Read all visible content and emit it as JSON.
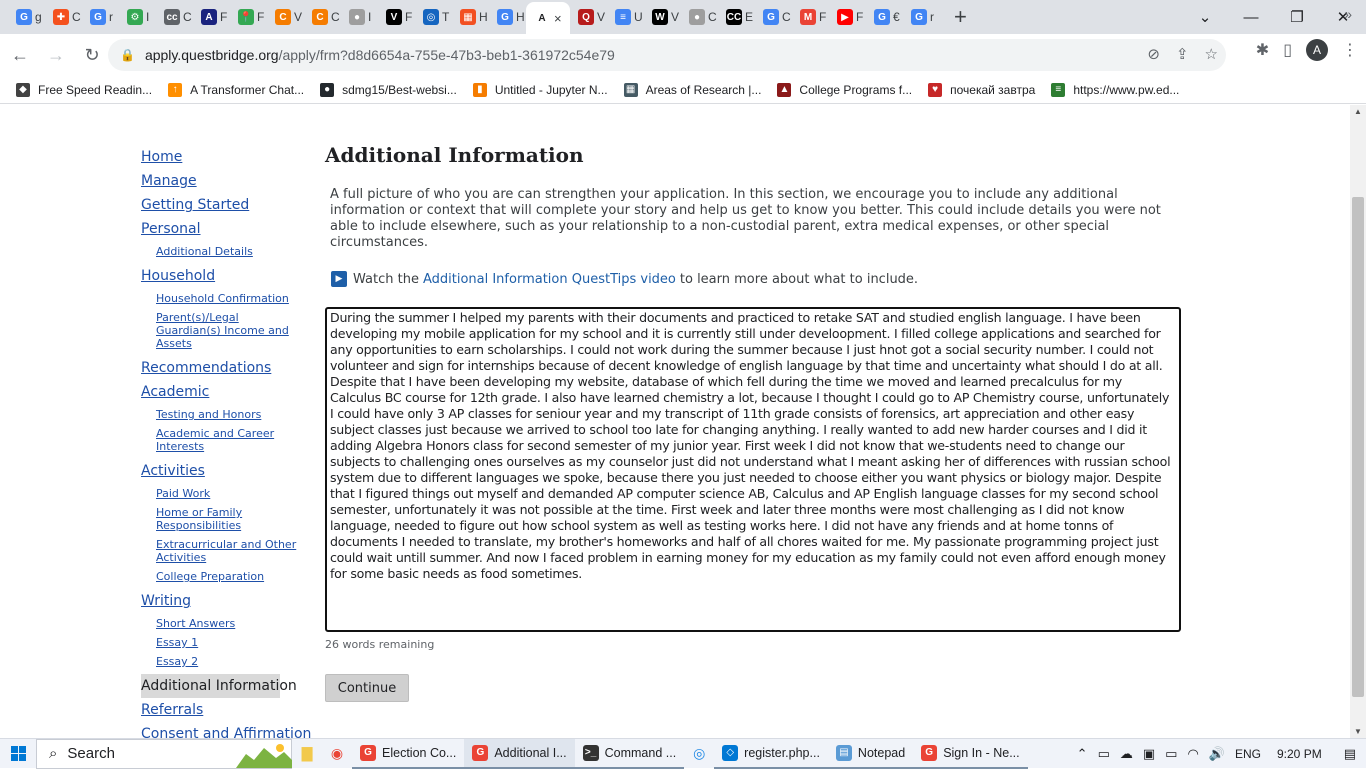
{
  "browser": {
    "tabs": [
      {
        "label": "G",
        "title": "g",
        "color": "#4285f4"
      },
      {
        "label": "✚",
        "title": "C",
        "color": "#f4511e"
      },
      {
        "label": "G",
        "title": "r",
        "color": "#4285f4"
      },
      {
        "label": "⚙",
        "title": "I",
        "color": "#34a853"
      },
      {
        "label": "cc",
        "title": "C",
        "color": "#5f6368"
      },
      {
        "label": "A",
        "title": "F",
        "color": "#1a237e"
      },
      {
        "label": "📍",
        "title": "F",
        "color": "#34a853"
      },
      {
        "label": "C",
        "title": "V",
        "color": "#f57c00"
      },
      {
        "label": "C",
        "title": "C",
        "color": "#f57c00"
      },
      {
        "label": "●",
        "title": "I",
        "color": "#9e9e9e"
      },
      {
        "label": "V",
        "title": "F",
        "color": "#000000"
      },
      {
        "label": "◎",
        "title": "T",
        "color": "#1565c0"
      },
      {
        "label": "▦",
        "title": "H",
        "color": "#f25022"
      },
      {
        "label": "G",
        "title": "H",
        "color": "#4285f4"
      },
      {
        "label": "A",
        "title": "",
        "color": "#ffffff",
        "active": true
      },
      {
        "label": "Q",
        "title": "V",
        "color": "#b71c1c"
      },
      {
        "label": "≡",
        "title": "U",
        "color": "#4285f4"
      },
      {
        "label": "W",
        "title": "V",
        "color": "#000000"
      },
      {
        "label": "●",
        "title": "C",
        "color": "#9e9e9e"
      },
      {
        "label": "CC",
        "title": "E",
        "color": "#000000"
      },
      {
        "label": "G",
        "title": "C",
        "color": "#4285f4"
      },
      {
        "label": "M",
        "title": "F",
        "color": "#ea4335"
      },
      {
        "label": "▶",
        "title": "F",
        "color": "#ff0000"
      },
      {
        "label": "G",
        "title": "€",
        "color": "#4285f4"
      },
      {
        "label": "G",
        "title": "r",
        "color": "#4285f4"
      }
    ],
    "active_tab_close": "×",
    "new_tab": "+",
    "url_host": "apply.questbridge.org",
    "url_path": "/apply/frm?d8d6654a-755e-47b3-beb1-361972c54e79",
    "profile_initial": "A",
    "bookmarks": [
      {
        "label": "Free Speed Readin...",
        "icon": "◆",
        "color": "#424242"
      },
      {
        "label": "A Transformer Chat...",
        "icon": "↑",
        "color": "#ff8f00"
      },
      {
        "label": "sdmg15/Best-websi...",
        "icon": "●",
        "color": "#24292e"
      },
      {
        "label": "Untitled - Jupyter N...",
        "icon": "▮",
        "color": "#f57c00"
      },
      {
        "label": "Areas of Research |...",
        "icon": "▦",
        "color": "#455a64"
      },
      {
        "label": "College Programs f...",
        "icon": "▲",
        "color": "#8b1a1a"
      },
      {
        "label": "почекай завтра",
        "icon": "♥",
        "color": "#c62828"
      },
      {
        "label": "https://www.pw.ed...",
        "icon": "≡",
        "color": "#2e7d32"
      }
    ]
  },
  "sidenav": [
    {
      "label": "Home",
      "level": 1
    },
    {
      "label": "Manage",
      "level": 1
    },
    {
      "label": "Getting Started",
      "level": 1
    },
    {
      "label": "Personal",
      "level": 1
    },
    {
      "label": "Additional Details",
      "level": 2
    },
    {
      "label": "Household",
      "level": 1
    },
    {
      "label": "Household Confirmation",
      "level": 2
    },
    {
      "label": "Parent(s)/Legal Guardian(s) Income and Assets",
      "level": 2
    },
    {
      "label": "Recommendations",
      "level": 1
    },
    {
      "label": "Academic",
      "level": 1
    },
    {
      "label": "Testing and Honors",
      "level": 2
    },
    {
      "label": "Academic and Career Interests",
      "level": 2
    },
    {
      "label": "Activities",
      "level": 1
    },
    {
      "label": "Paid Work",
      "level": 2
    },
    {
      "label": "Home or Family Responsibilities",
      "level": 2
    },
    {
      "label": "Extracurricular and Other Activities",
      "level": 2
    },
    {
      "label": "College Preparation",
      "level": 2
    },
    {
      "label": "Writing",
      "level": 1
    },
    {
      "label": "Short Answers",
      "level": 2
    },
    {
      "label": "Essay 1",
      "level": 2
    },
    {
      "label": "Essay 2",
      "level": 2
    },
    {
      "label": "Additional Information",
      "level": 1,
      "current": true
    },
    {
      "label": "Referrals",
      "level": 1
    },
    {
      "label": "Consent and Affirmation",
      "level": 1
    }
  ],
  "main": {
    "title": "Additional Information",
    "intro": "A full picture of who you are can strengthen your application. In this section, we encourage you to include any additional information or context that will complete your story and help us get to know you better. This could include details you were not able to include elsewhere, such as your relationship to a non-custodial parent, extra medical expenses, or other special circumstances.",
    "tips_prefix": "Watch the",
    "tips_link": "Additional Information QuestTips video",
    "tips_suffix": "to learn more about what to include.",
    "essay": "During the summer I helped my parents with their documents and practiced to retake SAT and studied english language. I have been developing my mobile application for my school and it is currently still under develoopment. I filled college applications  and searched for any opportunities to earn scholarships. I could not work during the summer because I just hnot got a social security number. I could not volunteer and sign for internships because of decent knowledge of english language by that time and uncertainty what should I do at all. Despite that I have been developing my website, database of which fell during the time we moved and learned precalculus for my Calculus BC course for 12th grade. I also have learned chemistry a lot, because I thought I could go to AP Chemistry course, unfortunately I could have only 3 AP classes for seniour year and my transcript of 11th grade consists of forensics, art appreciation and other easy subject classes just because we arrived to school too late for changing anything. I really wanted to add new harder courses and I did it adding Algebra Honors class for second semester of my junior year. First week I did not know that we-students need to change our subjects to challenging ones ourselves as my counselor just did not understand what I meant asking her of differences with russian school system due to different languages we spoke, because there you just needed to choose either you want physics or biology major. Despite that I figured things out myself and demanded AP computer science AB, Calculus and AP English language classes for my second school semester, unfortunately it was not possible at the time. First week and later three months were most challenging as I did not know language, needed to figure out how school system as well as testing works here. I did not have any friends and at home tonns of documents I needed to translate, my brother's homeworks and half of all chores waited for me. My passionate programming project just could wait untill summer. And now I faced problem in earning money for my education as my family could not even afford enough money for some basic needs as food sometimes.",
    "words_remaining": "26 words remaining",
    "continue_label": "Continue"
  },
  "taskbar": {
    "search_label": "Search",
    "apps": [
      {
        "label": "Election Co...",
        "icon": "G",
        "color": "#ea4335"
      },
      {
        "label": "Additional I...",
        "icon": "G",
        "color": "#ea4335",
        "active": true
      },
      {
        "label": "Command ...",
        "icon": ">_",
        "color": "#333333"
      },
      {
        "label": "register.php...",
        "icon": "◇",
        "color": "#0078d4"
      },
      {
        "label": "Notepad",
        "icon": "▤",
        "color": "#5b9bd5"
      },
      {
        "label": "Sign In - Ne...",
        "icon": "G",
        "color": "#ea4335"
      }
    ],
    "language": "ENG",
    "time": "9:20 PM"
  }
}
